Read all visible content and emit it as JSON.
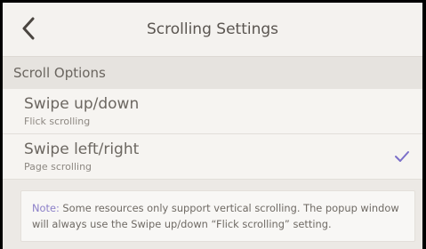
{
  "header": {
    "title": "Scrolling Settings",
    "back_icon": "chevron-left-icon"
  },
  "section": {
    "title": "Scroll Options"
  },
  "options": [
    {
      "label": "Swipe up/down",
      "sublabel": "Flick scrolling",
      "selected": false
    },
    {
      "label": "Swipe left/right",
      "sublabel": "Page scrolling",
      "selected": true
    }
  ],
  "note": {
    "prefix": "Note:",
    "text": " Some resources only support vertical scrolling. The popup window will always use the Swipe up/down “Flick scrolling” setting."
  },
  "colors": {
    "accent": "#7b6fc9",
    "note_label": "#8b7fc8"
  }
}
